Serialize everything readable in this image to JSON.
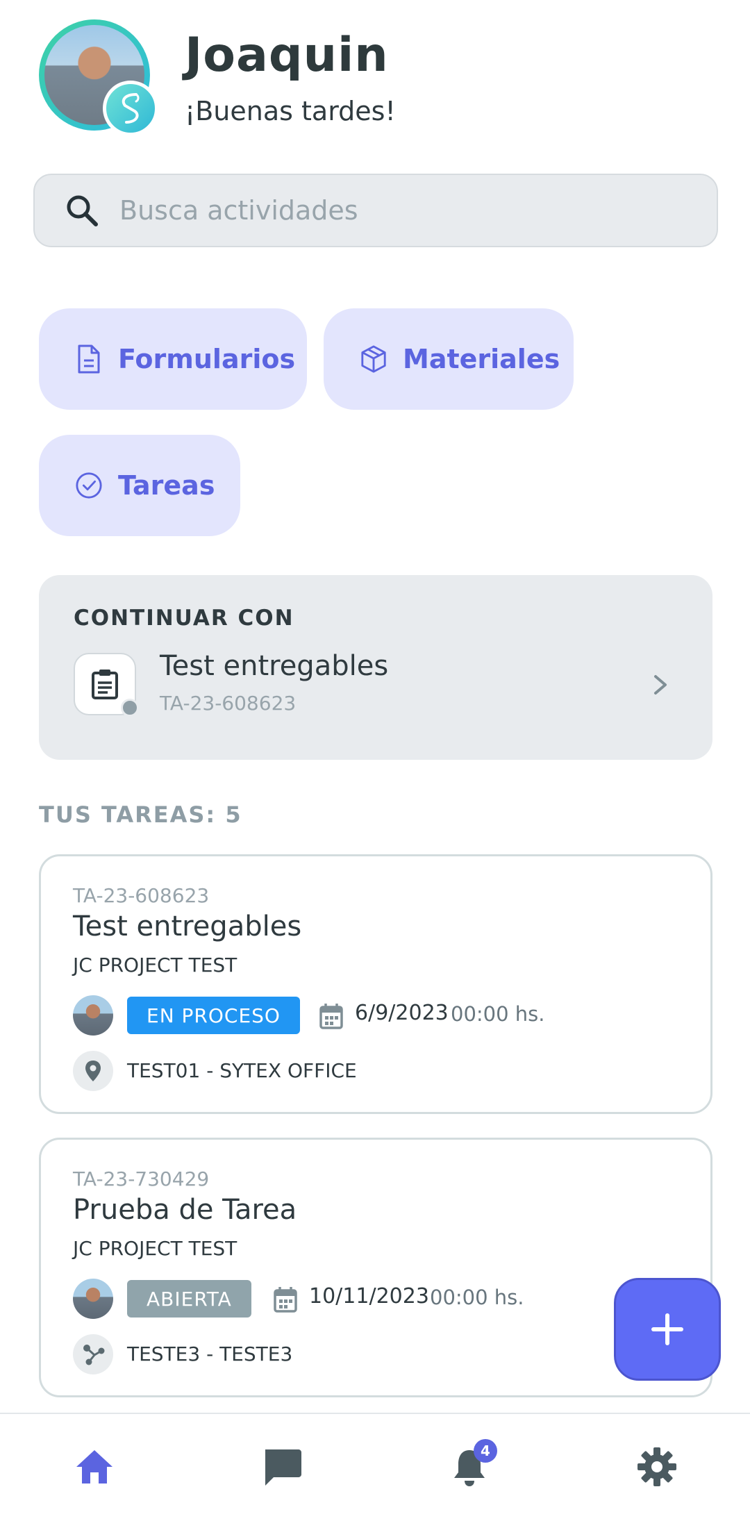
{
  "user": {
    "name": "Joaquin",
    "greeting": "¡Buenas tardes!"
  },
  "search": {
    "placeholder": "Busca actividades"
  },
  "shortcuts": [
    {
      "label": "Formularios",
      "icon": "document-icon"
    },
    {
      "label": "Materiales",
      "icon": "box-icon"
    },
    {
      "label": "Tareas",
      "icon": "check-circle-icon"
    }
  ],
  "continue": {
    "title": "CONTINUAR CON",
    "task_name": "Test entregables",
    "task_code": "TA-23-608623",
    "icon": "clipboard-icon"
  },
  "tasks_section": {
    "heading": "TUS TAREAS: 5"
  },
  "tasks": [
    {
      "code": "TA-23-608623",
      "title": "Test entregables",
      "project": "JC PROJECT TEST",
      "status": "EN PROCESO",
      "status_color": "#2196f3",
      "date": "6/9/2023",
      "time": "00:00 hs.",
      "site": "TEST01 - SYTEX OFFICE",
      "site_icon": "location-pin-icon"
    },
    {
      "code": "TA-23-730429",
      "title": "Prueba de Tarea",
      "project": "JC PROJECT TEST",
      "status": "ABIERTA",
      "status_color": "#90a4ab",
      "date": "10/11/2023",
      "time": "00:00 hs.",
      "site": "TESTE3 - TESTE3",
      "site_icon": "network-icon"
    }
  ],
  "nav": {
    "items": [
      "home-icon",
      "chat-icon",
      "bell-icon",
      "gear-icon"
    ],
    "notifications_count": "4",
    "active_color": "#5b64e0",
    "inactive_color": "#4b5a60"
  },
  "fab": {
    "icon": "plus-icon",
    "color": "#5e6bf5"
  }
}
